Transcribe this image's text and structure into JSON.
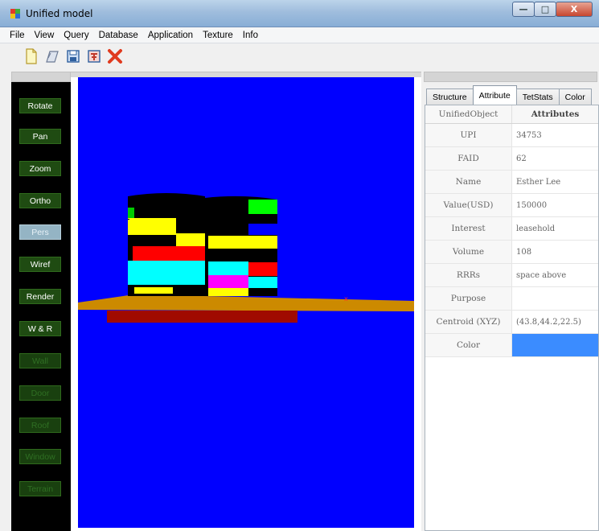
{
  "window": {
    "title": "Unified model",
    "controls": {
      "minimize": "—",
      "maximize": "□",
      "close": "X"
    }
  },
  "menu": [
    "File",
    "View",
    "Query",
    "Database",
    "Application",
    "Texture",
    "Info"
  ],
  "toolbar": [
    {
      "icon": "new-file-icon",
      "color": "#f3f080"
    },
    {
      "icon": "open-folder-icon",
      "color": "#9aa7c0"
    },
    {
      "icon": "save-icon",
      "color": "#3b6fb0"
    },
    {
      "icon": "export-icon",
      "color": "#c03b2b"
    },
    {
      "icon": "delete-icon",
      "color": "#e03a1e"
    }
  ],
  "tools": [
    {
      "label": "Rotate",
      "state": "normal"
    },
    {
      "label": "Pan",
      "state": "normal"
    },
    {
      "label": "Zoom",
      "state": "normal"
    },
    {
      "label": "Ortho",
      "state": "normal"
    },
    {
      "label": "Pers",
      "state": "active"
    },
    {
      "label": "Wiref",
      "state": "normal"
    },
    {
      "label": "Render",
      "state": "normal"
    },
    {
      "label": "W & R",
      "state": "normal"
    },
    {
      "label": "Wall",
      "state": "disabled"
    },
    {
      "label": "Door",
      "state": "disabled"
    },
    {
      "label": "Roof",
      "state": "disabled"
    },
    {
      "label": "Window",
      "state": "disabled"
    },
    {
      "label": "Terrain",
      "state": "disabled"
    }
  ],
  "viewport": {
    "background": "#0000ff"
  },
  "tabs": [
    {
      "label": "Structure",
      "active": false
    },
    {
      "label": "Attribute",
      "active": true
    },
    {
      "label": "TetStats",
      "active": false
    },
    {
      "label": "Color",
      "active": false
    }
  ],
  "table": {
    "headers": [
      "UnifiedObject",
      "Attributes"
    ],
    "rows": [
      {
        "key": "UPI",
        "value": "34753"
      },
      {
        "key": "FAID",
        "value": "62"
      },
      {
        "key": "Name",
        "value": "Esther Lee"
      },
      {
        "key": "Value(USD)",
        "value": "150000"
      },
      {
        "key": "Interest",
        "value": "leasehold"
      },
      {
        "key": "Volume",
        "value": "108"
      },
      {
        "key": "RRRs",
        "value": "space above"
      },
      {
        "key": "Purpose",
        "value": ""
      },
      {
        "key": "Centroid (XYZ)",
        "value": "(43.8,44.2,22.5)"
      },
      {
        "key": "Color",
        "value": "",
        "swatch": "#3b8cff"
      }
    ]
  }
}
